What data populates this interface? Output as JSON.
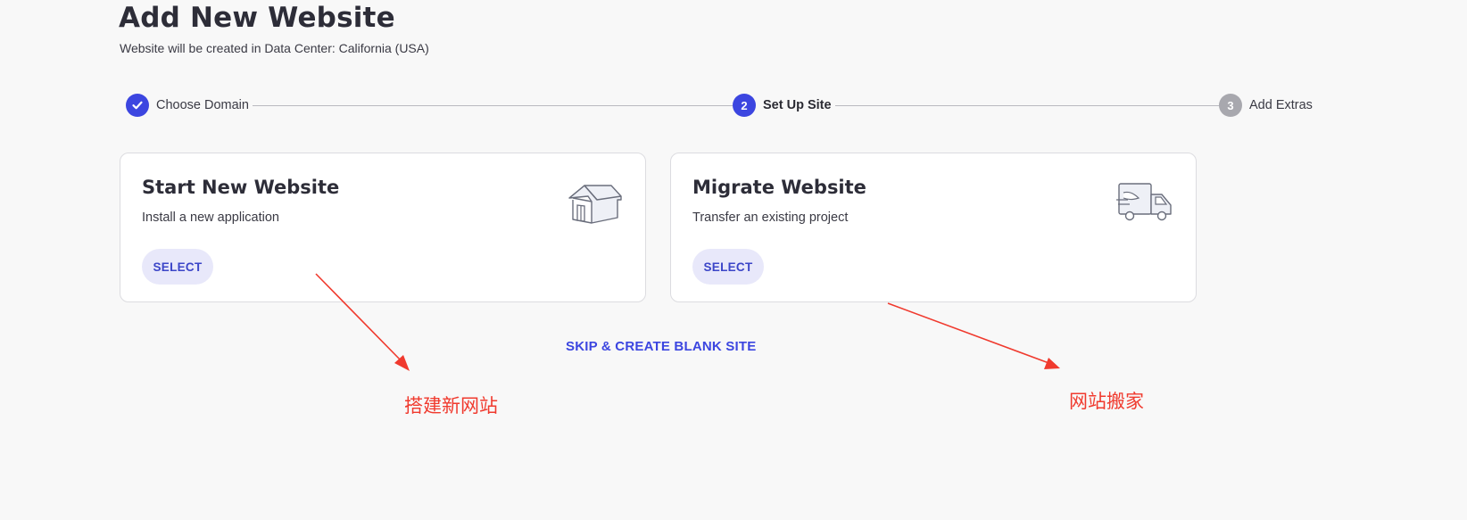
{
  "header": {
    "title": "Add New Website",
    "subtitle": "Website will be created in Data Center: California (USA)"
  },
  "stepper": {
    "steps": [
      {
        "label": "Choose Domain",
        "state": "done",
        "marker": "check-icon"
      },
      {
        "label": "Set Up Site",
        "state": "active",
        "marker": "2"
      },
      {
        "label": "Add Extras",
        "state": "pending",
        "marker": "3"
      }
    ]
  },
  "cards": [
    {
      "title": "Start New Website",
      "description": "Install a new application",
      "button_label": "SELECT",
      "icon": "house-icon"
    },
    {
      "title": "Migrate Website",
      "description": "Transfer an existing project",
      "button_label": "SELECT",
      "icon": "moving-truck-icon"
    }
  ],
  "skip_link": "SKIP & CREATE BLANK SITE",
  "annotations": {
    "left_note": "搭建新网站",
    "right_note": "网站搬家"
  },
  "colors": {
    "accent": "#3c46e0",
    "annotation": "#f03a2e",
    "background": "#f8f8f8"
  }
}
